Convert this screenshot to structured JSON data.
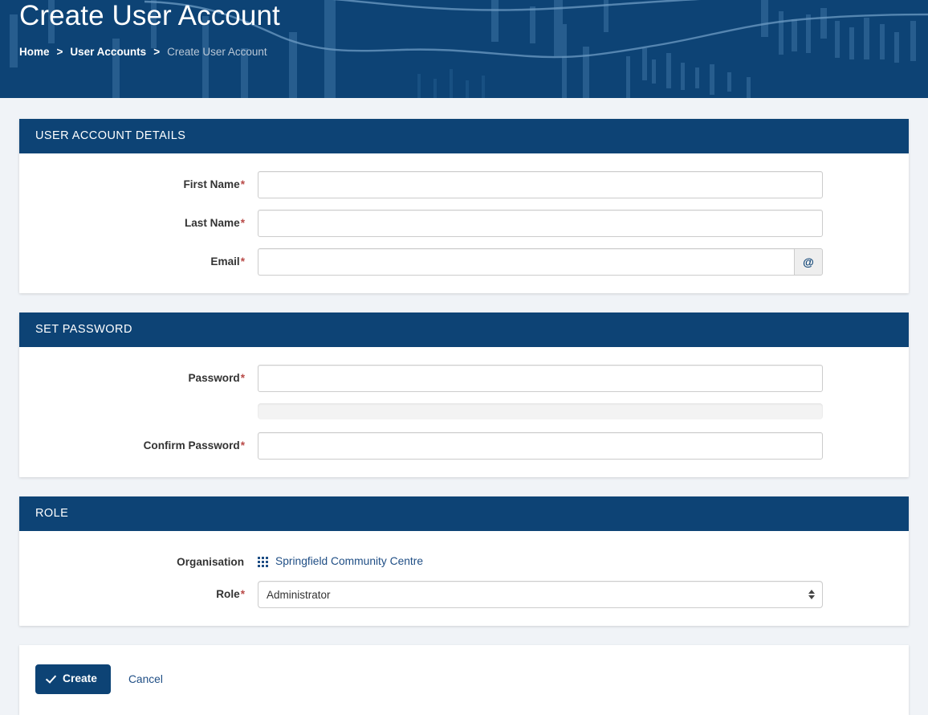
{
  "header": {
    "title": "Create User Account",
    "breadcrumb": [
      {
        "label": "Home",
        "current": false
      },
      {
        "label": "User Accounts",
        "current": false
      },
      {
        "label": "Create User Account",
        "current": true
      }
    ],
    "separator": ">",
    "background_color": "#0d4375"
  },
  "panels": {
    "account": {
      "heading": "USER ACCOUNT DETAILS",
      "fields": {
        "first_name": {
          "label": "First Name",
          "required_mark": "*",
          "value": "",
          "placeholder": ""
        },
        "last_name": {
          "label": "Last Name",
          "required_mark": "*",
          "value": "",
          "placeholder": ""
        },
        "email": {
          "label": "Email",
          "required_mark": "*",
          "value": "",
          "placeholder": "",
          "addon_icon": "at-sign-icon",
          "addon_label": "@"
        }
      }
    },
    "password": {
      "heading": "SET PASSWORD",
      "fields": {
        "password": {
          "label": "Password",
          "required_mark": "*",
          "value": "",
          "placeholder": ""
        },
        "confirm_password": {
          "label": "Confirm Password",
          "required_mark": "*",
          "value": "",
          "placeholder": ""
        }
      },
      "strength_meter": {
        "percent": 0,
        "label": ""
      }
    },
    "role": {
      "heading": "ROLE",
      "fields": {
        "organisation": {
          "label": "Organisation",
          "required_mark": "",
          "value": "Springfield Community Centre",
          "icon": "grid-icon"
        },
        "role": {
          "label": "Role",
          "required_mark": "*",
          "value": "Administrator",
          "options": [
            "Administrator"
          ]
        }
      }
    }
  },
  "actions": {
    "create_label": "Create",
    "create_icon": "check-icon",
    "cancel_label": "Cancel"
  },
  "colors": {
    "navy": "#0d4375",
    "page_bg": "#f0f3f7",
    "required": "#b94a48",
    "link": "#1f4e85"
  }
}
